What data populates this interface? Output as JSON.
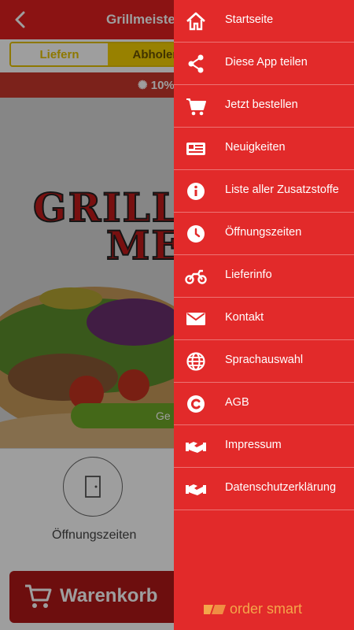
{
  "app": {
    "title": "Grillmeister",
    "toggle": {
      "deliver": "Liefern",
      "pickup": "Abholen"
    },
    "promo": "10%",
    "hero_logo": {
      "line1": "GRILL",
      "line2": "ME"
    },
    "green_button": "Ge",
    "opening_hours_label": "Öffnungszeiten",
    "cart_label": "Warenkorb"
  },
  "menu": [
    {
      "label": "Startseite",
      "icon": "home-icon"
    },
    {
      "label": "Diese App teilen",
      "icon": "share-icon"
    },
    {
      "label": "Jetzt bestellen",
      "icon": "cart-icon"
    },
    {
      "label": "Neuigkeiten",
      "icon": "news-icon"
    },
    {
      "label": "Liste aller Zusatzstoffe",
      "icon": "info-icon"
    },
    {
      "label": "Öffnungszeiten",
      "icon": "clock-icon"
    },
    {
      "label": "Lieferinfo",
      "icon": "motorcycle-icon"
    },
    {
      "label": "Kontakt",
      "icon": "mail-icon"
    },
    {
      "label": "Sprachauswahl",
      "icon": "globe-icon"
    },
    {
      "label": "AGB",
      "icon": "copyright-icon"
    },
    {
      "label": "Impressum",
      "icon": "handshake-icon"
    },
    {
      "label": "Datenschutzerklärung",
      "icon": "handshake-icon"
    }
  ],
  "brand": {
    "name": "order smart"
  },
  "colors": {
    "primary": "#e22a2a",
    "accent": "#f5d000",
    "brand": "#f4a64a"
  }
}
